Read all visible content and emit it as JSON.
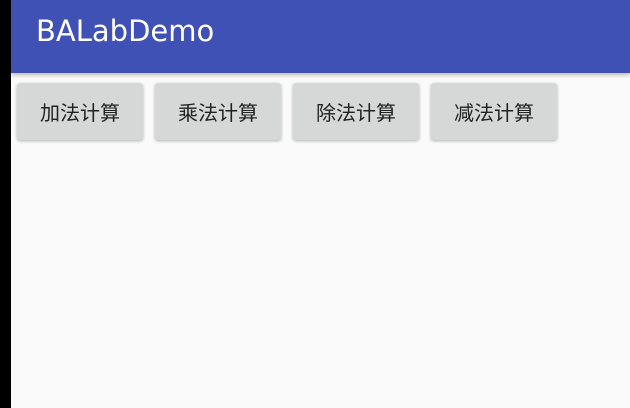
{
  "app_bar": {
    "title": "BALabDemo",
    "color": "#3f51b5"
  },
  "buttons": [
    {
      "label": "加法计算"
    },
    {
      "label": "乘法计算"
    },
    {
      "label": "除法计算"
    },
    {
      "label": "减法计算"
    }
  ]
}
